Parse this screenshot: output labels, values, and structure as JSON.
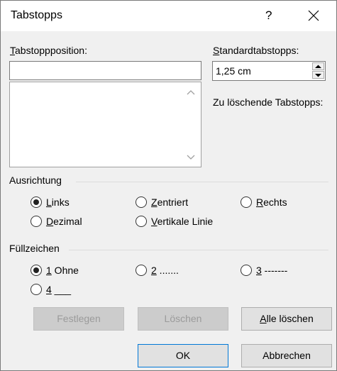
{
  "window": {
    "title": "Tabstopps",
    "help": "?"
  },
  "tabposition": {
    "label": "Tabstoppposition:",
    "value": ""
  },
  "standard": {
    "label": "Standardtabstopps:",
    "value": "1,25 cm"
  },
  "clear_label": "Zu löschende Tabstopps:",
  "alignment": {
    "title": "Ausrichtung",
    "options": [
      {
        "label": "Links",
        "checked": true
      },
      {
        "label": "Zentriert",
        "checked": false
      },
      {
        "label": "Rechts",
        "checked": false
      },
      {
        "label": "Dezimal",
        "checked": false
      },
      {
        "label": "Vertikale Linie",
        "checked": false
      }
    ]
  },
  "leader": {
    "title": "Füllzeichen",
    "options": [
      {
        "label": "1 Ohne",
        "checked": true
      },
      {
        "label": "2 .......",
        "checked": false
      },
      {
        "label": "3 -------",
        "checked": false
      },
      {
        "label": "4 ___",
        "checked": false
      }
    ]
  },
  "buttons": {
    "set": "Festlegen",
    "clear": "Löschen",
    "clear_all": "Alle löschen",
    "ok": "OK",
    "cancel": "Abbrechen"
  }
}
